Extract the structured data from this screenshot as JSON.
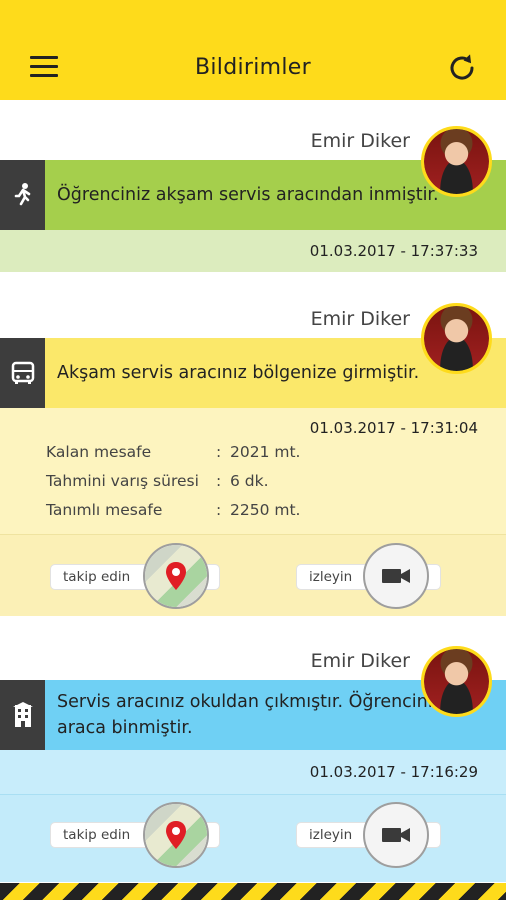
{
  "header": {
    "title": "Bildirimler"
  },
  "notifications": [
    {
      "person": "Emir Diker",
      "message": "Öğrenciniz akşam servis aracından inmiştir.",
      "timestamp": "01.03.2017 - 17:37:33",
      "icon": "walking-person-icon"
    },
    {
      "person": "Emir Diker",
      "message": "Akşam servis aracınız bölgenize girmiştir.",
      "timestamp": "01.03.2017 - 17:31:04",
      "icon": "bus-icon",
      "details": [
        {
          "label": "Kalan mesafe",
          "value": "2021 mt."
        },
        {
          "label": "Tahmini varış süresi",
          "value": "6 dk."
        },
        {
          "label": "Tanımlı mesafe",
          "value": "2250 mt."
        }
      ],
      "actions": {
        "track": "takip edin",
        "watch": "izleyin"
      }
    },
    {
      "person": "Emir Diker",
      "message": "Servis aracınız okuldan çıkmıştır. Öğrenciniz araca binmiştir.",
      "timestamp": "01.03.2017 - 17:16:29",
      "icon": "school-building-icon",
      "actions": {
        "track": "takip edin",
        "watch": "izleyin"
      }
    }
  ],
  "colors": {
    "header": "#fedb1b",
    "green": "#a5cf4c",
    "green_light": "#dcecbe",
    "yellow": "#fbe86a",
    "yellow_light": "#fdf4bf",
    "blue": "#6fd0f4",
    "blue_light": "#c8edfb",
    "icon_bg": "#3d3d3d"
  }
}
